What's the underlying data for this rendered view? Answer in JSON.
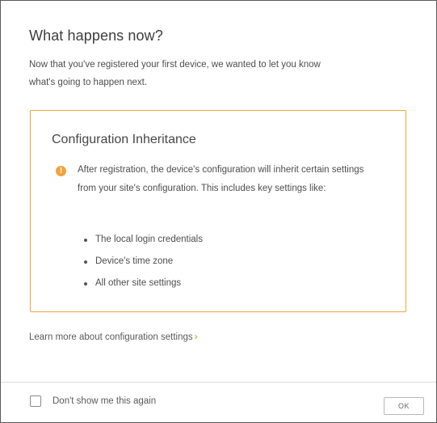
{
  "dialog": {
    "title": "What happens now?",
    "intro_line1": "Now that you've registered your first device, we wanted to let you know",
    "intro_line2": "what's going to happen next.",
    "callout": {
      "title": "Configuration Inheritance",
      "icon": "warning-icon",
      "icon_glyph": "!",
      "text": "After registration, the device's configuration will inherit certain settings from your site's configuration. This includes key settings like:",
      "bullets": [
        "The local login credentials",
        "Device's time zone",
        "All other site settings"
      ],
      "accent_color": "#f0a43a"
    },
    "learn_more": {
      "label": "Learn more about configuration settings",
      "chevron": "›"
    },
    "footer": {
      "checkbox_label": "Don't show me this again",
      "checkbox_checked": false,
      "ok_label": "OK"
    }
  }
}
